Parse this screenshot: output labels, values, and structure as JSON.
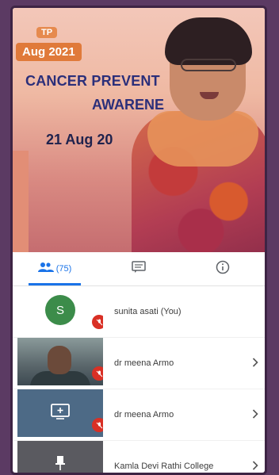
{
  "banner": {
    "date_chip_small": "TP",
    "date_chip": "Aug 2021",
    "line1": "CANCER PREVENT",
    "line2": "AWARENE",
    "date": "21 Aug 20"
  },
  "tabs": [
    {
      "name": "people",
      "count": "(75)",
      "active": true
    },
    {
      "name": "chat",
      "active": false
    },
    {
      "name": "info",
      "active": false
    }
  ],
  "participants": [
    {
      "initial": "S",
      "name": "sunita asati (You)",
      "has_chevron": false,
      "tile": "avatar"
    },
    {
      "name": "dr meena Armo",
      "has_chevron": true,
      "tile": "camera"
    },
    {
      "name": "dr meena Armo",
      "has_chevron": true,
      "tile": "screen-share"
    },
    {
      "name": "Kamla Devi Rathi College",
      "has_chevron": true,
      "tile": "pin"
    }
  ],
  "icons": {
    "people": "people-icon",
    "chat": "chat-icon",
    "info": "info-icon",
    "chevron": "chevron-right-icon",
    "mic_off": "mic-off-icon"
  },
  "colors": {
    "accent": "#1a73e8",
    "mic_off": "#d93025",
    "avatar": "#3c8c4a"
  }
}
